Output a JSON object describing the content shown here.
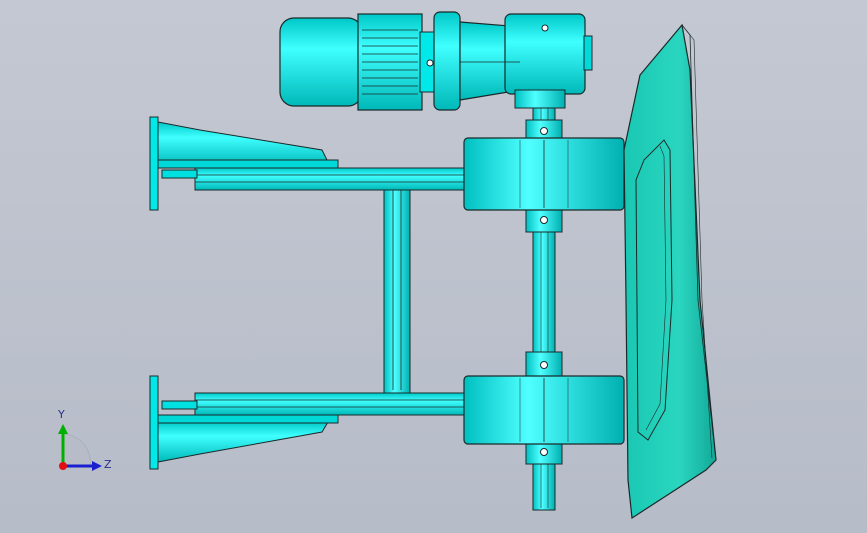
{
  "viewport": {
    "background_top": "#c4c8d2",
    "background_bottom": "#b6bcc8"
  },
  "model": {
    "colors": {
      "cyan": "#00f0f0",
      "cyan_dark": "#00c8c8",
      "teal_plate": "#20c8b0",
      "outline": "#1a2a2a"
    },
    "parts": [
      "gear-motor",
      "gearbox",
      "drive-shaft",
      "upper-bearing-housing",
      "lower-bearing-housing",
      "frame-upper-arm",
      "frame-lower-arm",
      "frame-cross-member",
      "upper-mount-bracket",
      "lower-mount-bracket",
      "blade-plate"
    ]
  },
  "triad": {
    "y_label": "Y",
    "z_label": "Z",
    "y_color": "#00b000",
    "z_color": "#1a20d0",
    "x_color": "#e01010"
  }
}
